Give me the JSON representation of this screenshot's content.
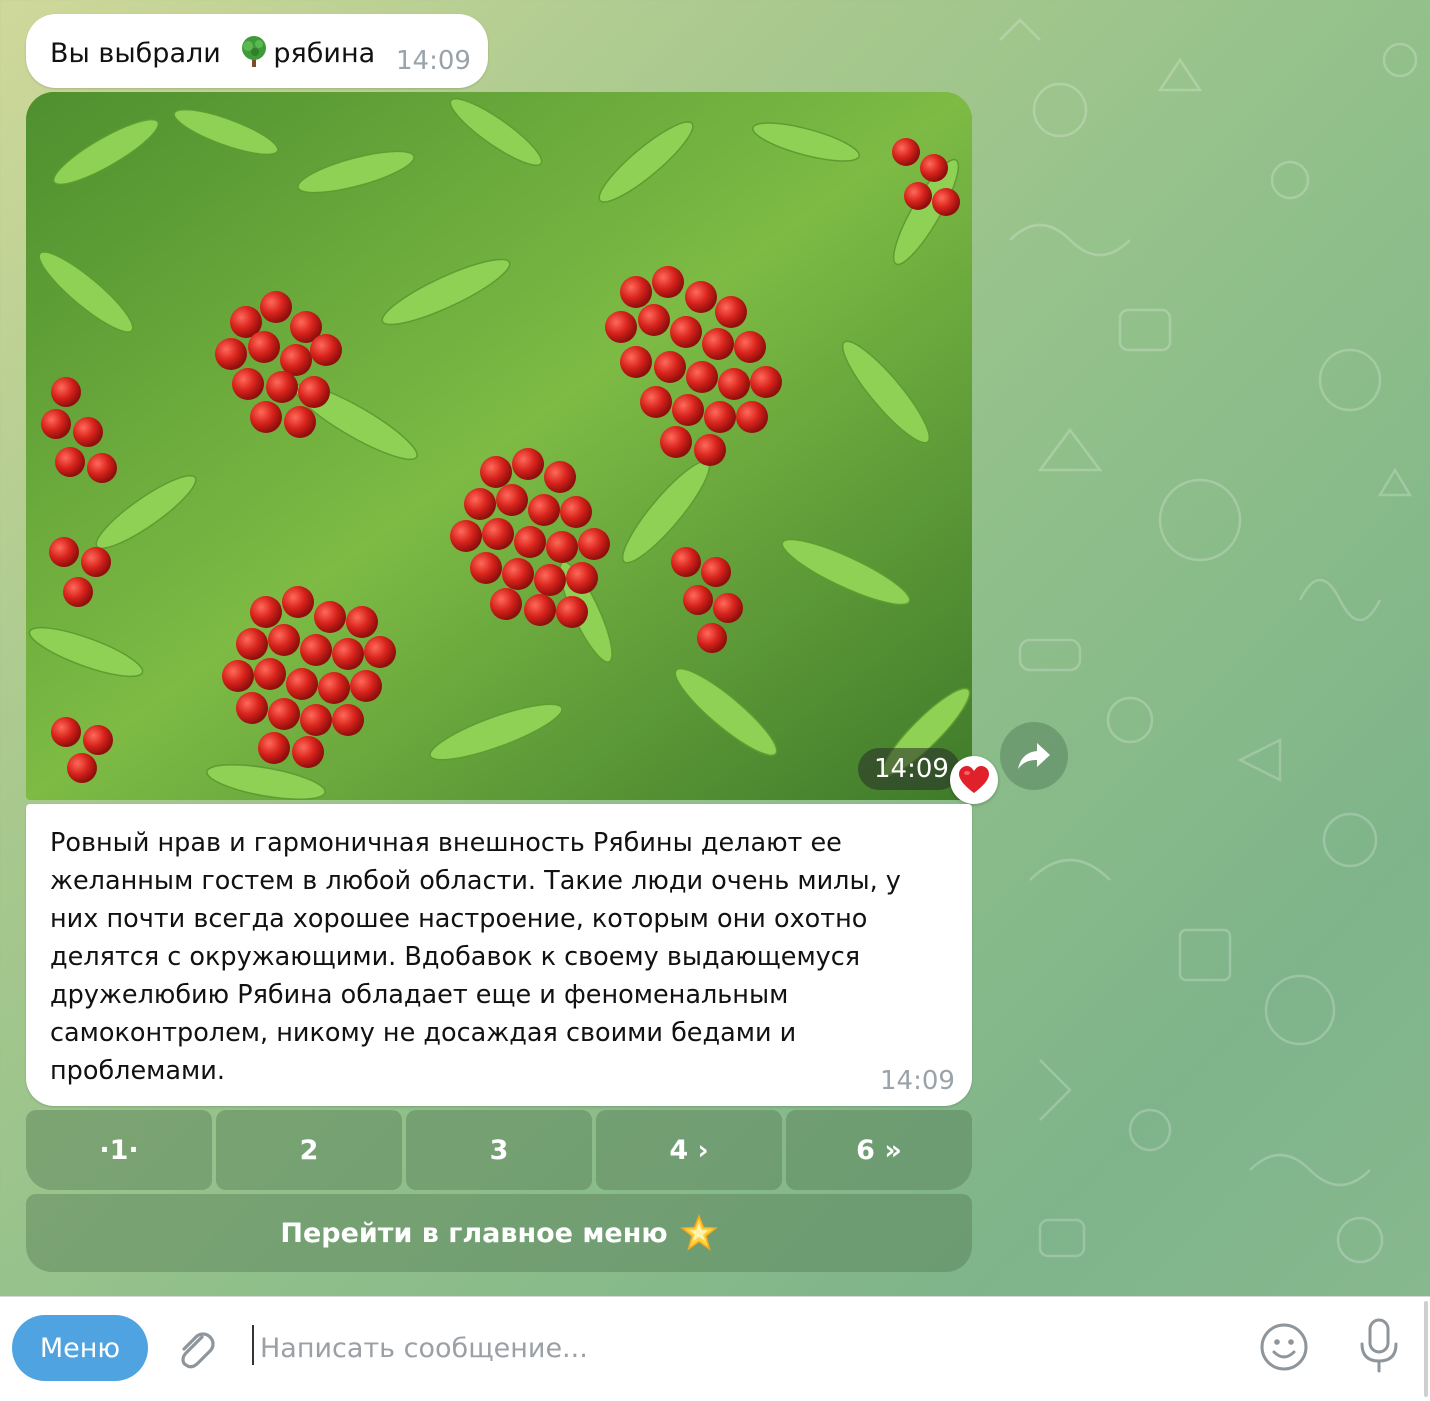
{
  "chat": {
    "message1": {
      "text_before": "Вы выбрали ",
      "emoji_icon": "deciduous-tree-icon",
      "text_after": "рябина",
      "time": "14:09"
    },
    "photo": {
      "description_icon": "rowan-berries-photo",
      "time": "14:09",
      "reaction_icon": "red-heart-icon",
      "forward_icon": "share-arrow-icon"
    },
    "message2": {
      "text": "Ровный нрав и гармоничная внешность Рябины делают ее желанным гостем в любой области. Такие люди очень милы, у них почти всегда хорошее настроение, которым они охотно делятся с окружающими. Вдобавок к своему выдающемуся дружелюбию Рябина обладает еще и феноменальным самоконтролем, никому не досаждая своими бедами и проблемами.",
      "time": "14:09"
    },
    "keyboard": {
      "pages": [
        "·1·",
        "2",
        "3",
        "4 ›",
        "6 »"
      ],
      "main_menu_label": "Перейти в главное меню",
      "main_menu_icon": "glowing-star-icon"
    }
  },
  "composer": {
    "menu_label": "Меню",
    "placeholder": "Написать сообщение...",
    "attach_icon": "paperclip-icon",
    "emoji_icon": "smiley-icon",
    "mic_icon": "microphone-icon"
  },
  "colors": {
    "menu_button": "#4fa3e0",
    "heart": "#e0202a",
    "inline_button": "#5a8a5c"
  }
}
